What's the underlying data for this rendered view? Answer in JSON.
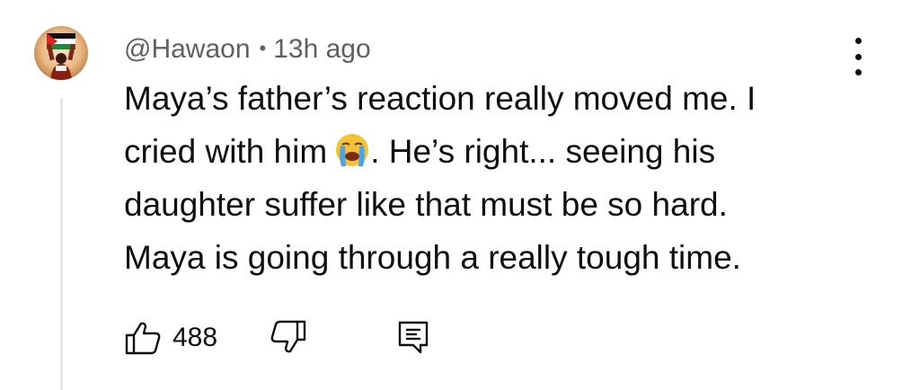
{
  "comment": {
    "author": "@Hawaon",
    "separator": "•",
    "time_ago": "13h ago",
    "text_line1": "Maya’s father’s reaction really moved me. I",
    "text_line2_before_emoji": "cried with him",
    "emoji": "loudly-crying-face-emoji",
    "text_line2_after_emoji": ". He’s right... seeing his",
    "text_line3": "daughter suffer like that must be so hard.",
    "text_line4": "Maya is going through a really tough time.",
    "like_count": "488"
  },
  "icons": {
    "avatar": "avatar-person-holding-flag",
    "more": "more-vertical-icon",
    "like": "thumbs-up-icon",
    "dislike": "thumbs-down-icon",
    "reply": "reply-comment-icon"
  },
  "colors": {
    "text_primary": "#0f0f0f",
    "text_secondary": "#606060",
    "thread_line": "#e5e5e5",
    "background": "#ffffff"
  }
}
